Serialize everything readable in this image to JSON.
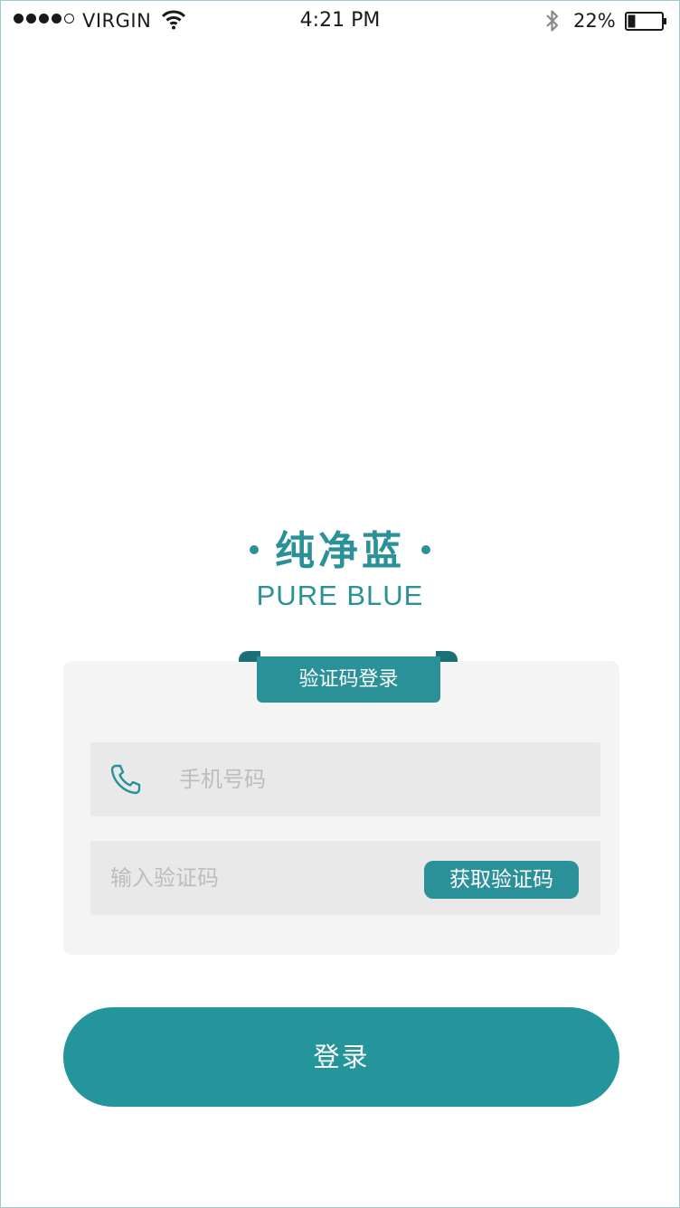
{
  "status_bar": {
    "carrier": "VIRGIN",
    "time": "4:21 PM",
    "battery_percent": "22%",
    "battery_level": 0.22,
    "signal_bars": 4,
    "signal_total": 5
  },
  "brand": {
    "title": "纯净蓝",
    "subtitle": "PURE BLUE"
  },
  "login_card": {
    "tab_label": "验证码登录",
    "phone_placeholder": "手机号码",
    "code_placeholder": "输入验证码",
    "get_code_label": "获取验证码"
  },
  "login_button": {
    "label": "登录"
  },
  "icons": {
    "phone": "phone-icon",
    "wifi": "wifi-icon",
    "bluetooth": "bluetooth-icon",
    "battery": "battery-icon"
  },
  "colors": {
    "accent": "#2a9198",
    "button": "#24959b",
    "field_bg": "#e9e9e9",
    "card_bg": "#f4f4f4"
  }
}
